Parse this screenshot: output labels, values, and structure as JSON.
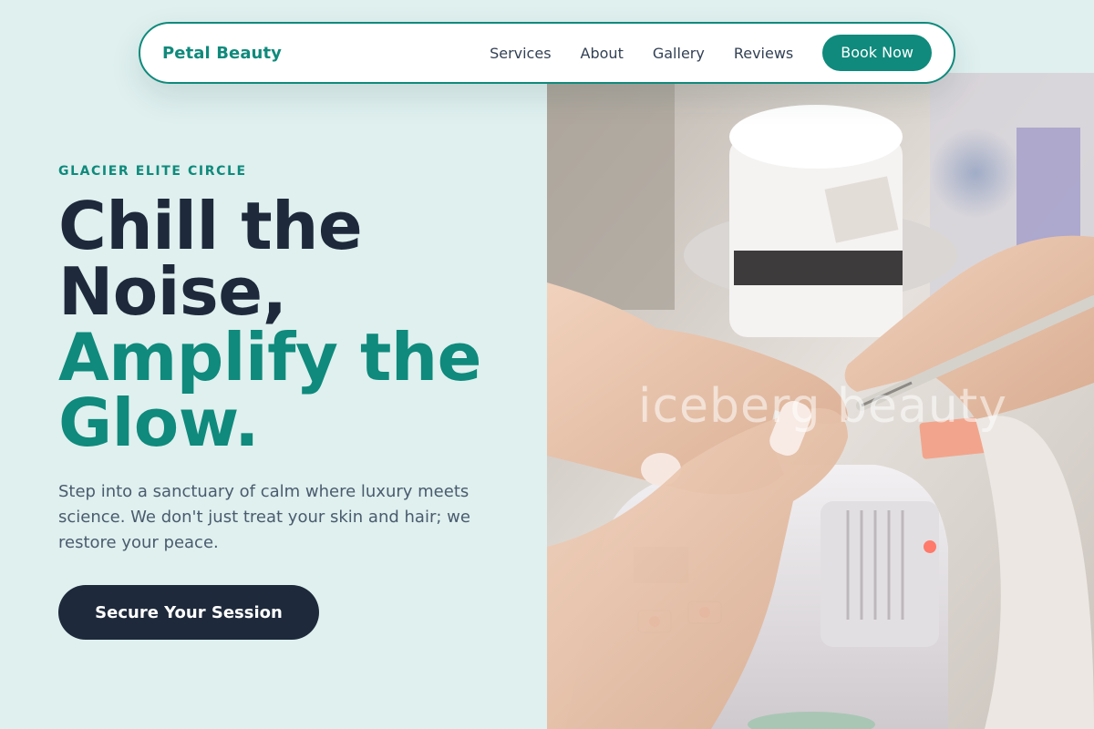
{
  "brand": {
    "name": "Petal Beauty"
  },
  "nav": {
    "links": [
      "Services",
      "About",
      "Gallery",
      "Reviews"
    ],
    "book_label": "Book Now"
  },
  "hero": {
    "eyebrow": "GLACIER ELITE CIRCLE",
    "headline_line1": "Chill the",
    "headline_line2": "Noise,",
    "headline_line3": "Amplify the",
    "headline_line4": "Glow.",
    "lead": "Step into a sanctuary of calm where luxury meets science. We don't just treat your skin and hair; we restore your peace.",
    "cta_label": "Secure Your Session",
    "image_watermark": "iceberg beauty"
  },
  "colors": {
    "background": "#dff0ef",
    "accent": "#0f8a7c",
    "dark": "#1e293b",
    "body_text": "#4b5b6e"
  }
}
